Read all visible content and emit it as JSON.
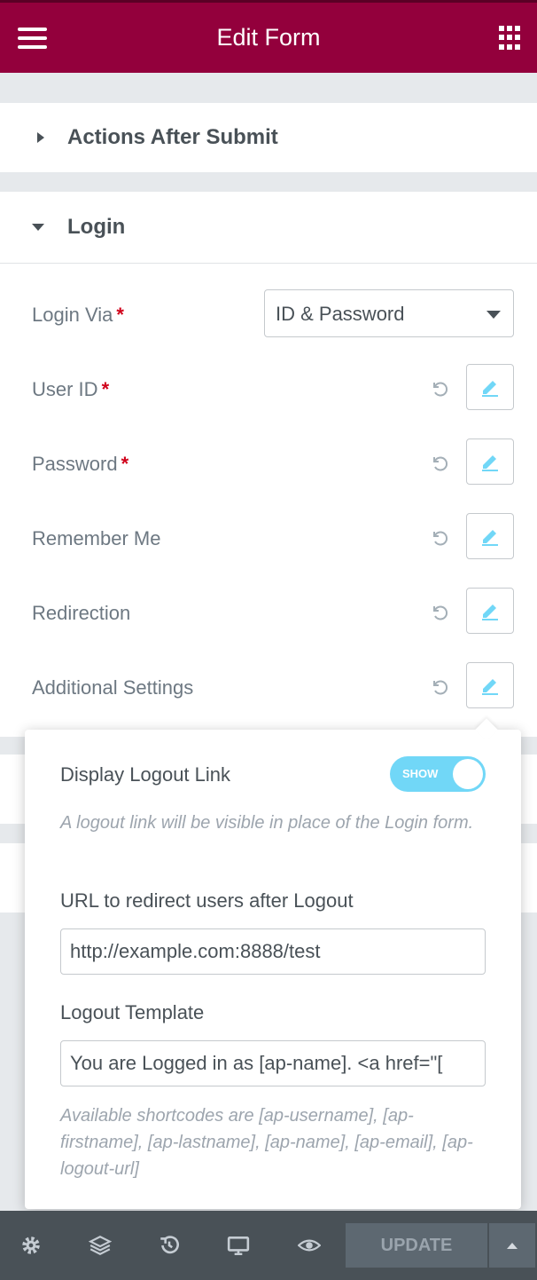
{
  "header": {
    "title": "Edit Form"
  },
  "sections": {
    "actions_after_submit": "Actions After Submit",
    "login": "Login"
  },
  "login": {
    "login_via": {
      "label": "Login Via",
      "value": "ID & Password"
    },
    "rows": [
      {
        "label": "User ID",
        "required": true
      },
      {
        "label": "Password",
        "required": true
      },
      {
        "label": "Remember Me",
        "required": false
      },
      {
        "label": "Redirection",
        "required": false
      },
      {
        "label": "Additional Settings",
        "required": false
      }
    ],
    "required_mark": "*"
  },
  "popover": {
    "display_logout_label": "Display Logout Link",
    "toggle_text": "SHOW",
    "display_logout_note": "A logout link will be visible in place of the Login form.",
    "redirect_label": "URL to redirect users after Logout",
    "redirect_value": "http://example.com:8888/test",
    "template_label": "Logout Template",
    "template_value": "You are Logged in as [ap-name]. <a href=\"[",
    "shortcodes_note": "Available shortcodes are [ap-username], [ap-firstname], [ap-lastname], [ap-name], [ap-email], [ap-logout-url]"
  },
  "footer": {
    "update_label": "UPDATE"
  },
  "colors": {
    "brand": "#93003c",
    "accent": "#71d7f7",
    "required": "#d0021b",
    "footer": "#495157"
  }
}
